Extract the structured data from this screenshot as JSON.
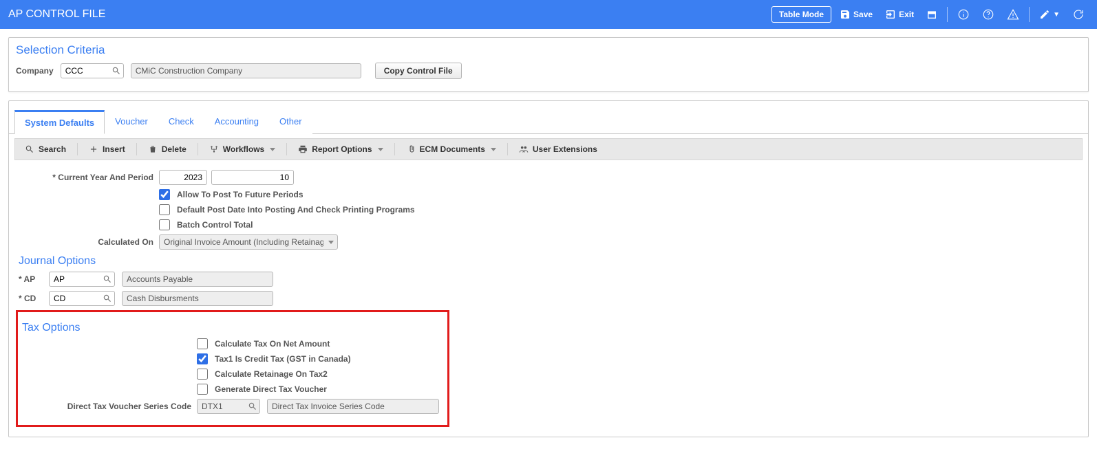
{
  "header": {
    "title": "AP CONTROL FILE",
    "table_mode": "Table Mode",
    "save": "Save",
    "exit": "Exit"
  },
  "selection": {
    "title": "Selection Criteria",
    "company_label": "Company",
    "company_value": "CCC",
    "company_desc": "CMiC Construction Company",
    "copy_btn": "Copy Control File"
  },
  "tabs": {
    "t0": "System Defaults",
    "t1": "Voucher",
    "t2": "Check",
    "t3": "Accounting",
    "t4": "Other"
  },
  "toolbar": {
    "search": "Search",
    "insert": "Insert",
    "delete": "Delete",
    "workflows": "Workflows",
    "report": "Report Options",
    "ecm": "ECM Documents",
    "userext": "User Extensions"
  },
  "sys_defaults": {
    "year_period_label": "* Current Year And Period",
    "year": "2023",
    "period": "10",
    "allow_future": "Allow To Post To Future Periods",
    "default_post_date": "Default Post Date Into Posting And Check Printing Programs",
    "batch_control": "Batch Control Total",
    "calc_on_label": "Calculated On",
    "calc_on_value": "Original Invoice Amount (Including Retainage"
  },
  "journal": {
    "title": "Journal Options",
    "ap_label": "* AP",
    "ap_value": "AP",
    "ap_desc": "Accounts Payable",
    "cd_label": "* CD",
    "cd_value": "CD",
    "cd_desc": "Cash Disbursments"
  },
  "tax": {
    "title": "Tax Options",
    "calc_net": "Calculate Tax On Net Amount",
    "tax1_credit": "Tax1 Is Credit Tax (GST in Canada)",
    "calc_ret_tax2": "Calculate Retainage On Tax2",
    "gen_direct": "Generate Direct Tax Voucher",
    "series_label": "Direct Tax Voucher Series Code",
    "series_value": "DTX1",
    "series_desc": "Direct Tax Invoice Series Code"
  }
}
